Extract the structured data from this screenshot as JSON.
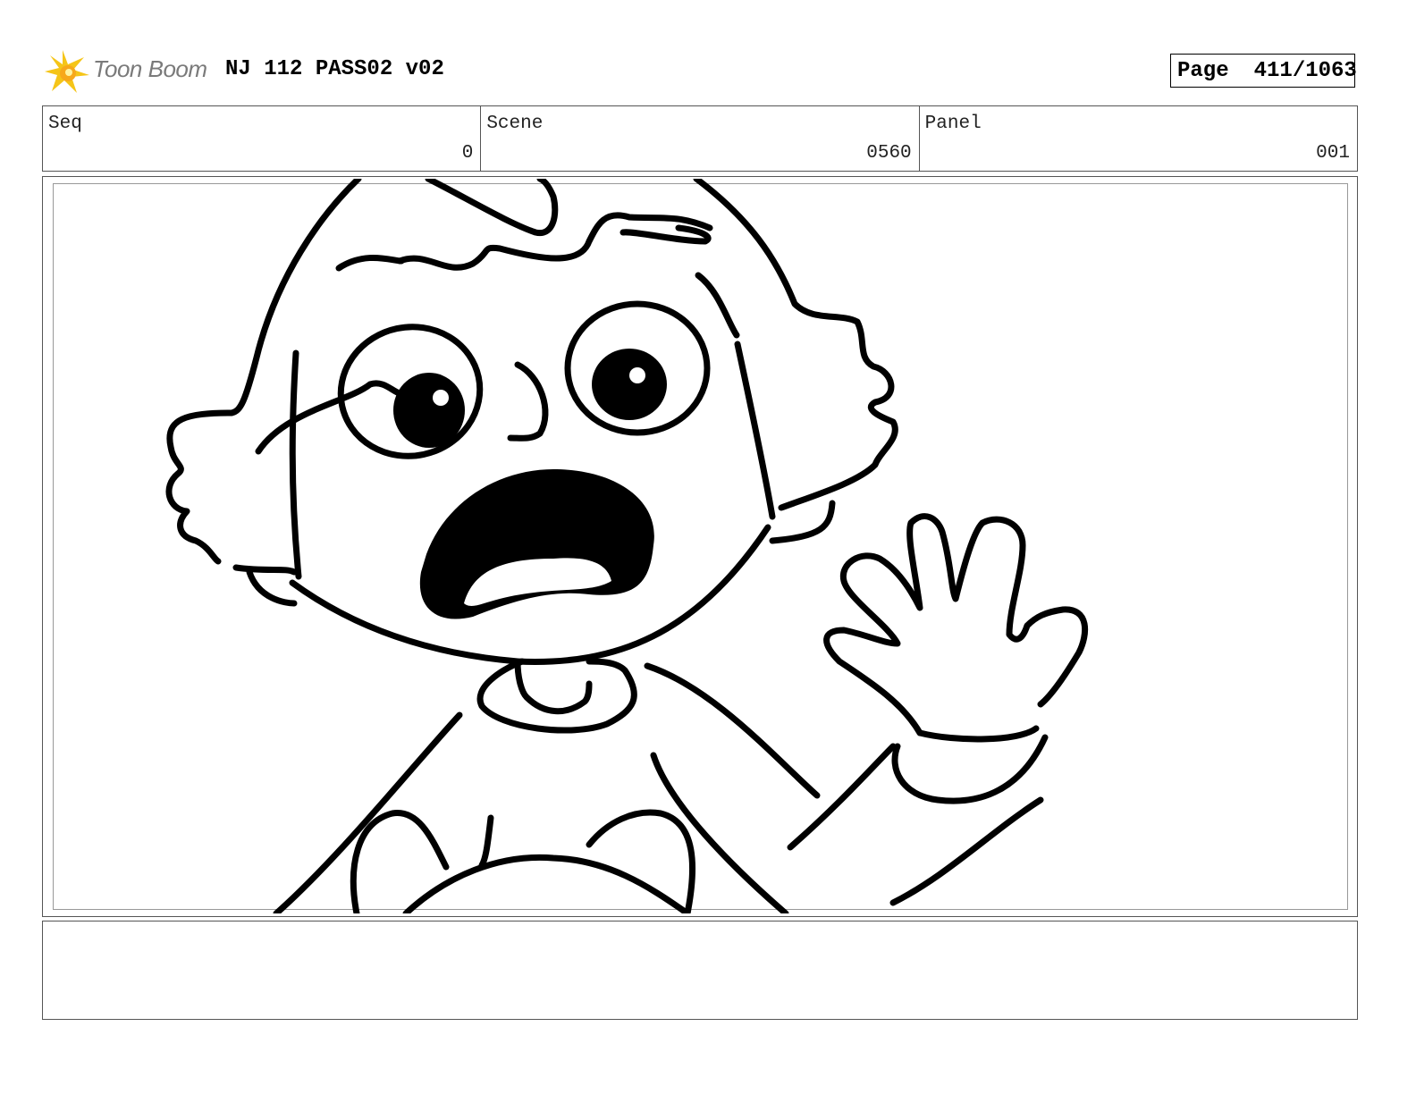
{
  "header": {
    "logo_text": "Toon Boom",
    "title": "NJ 112 PASS02 v02",
    "page_label": "Page",
    "page_number": "411/1063"
  },
  "info": {
    "seq_label": "Seq",
    "seq_value": "0",
    "scene_label": "Scene",
    "scene_value": "0560",
    "panel_label": "Panel",
    "panel_value": "001"
  },
  "notes": {
    "text": ""
  },
  "colors": {
    "logo_star": "#f5c518",
    "logo_text": "#7a7a7a",
    "ink": "#000000"
  }
}
